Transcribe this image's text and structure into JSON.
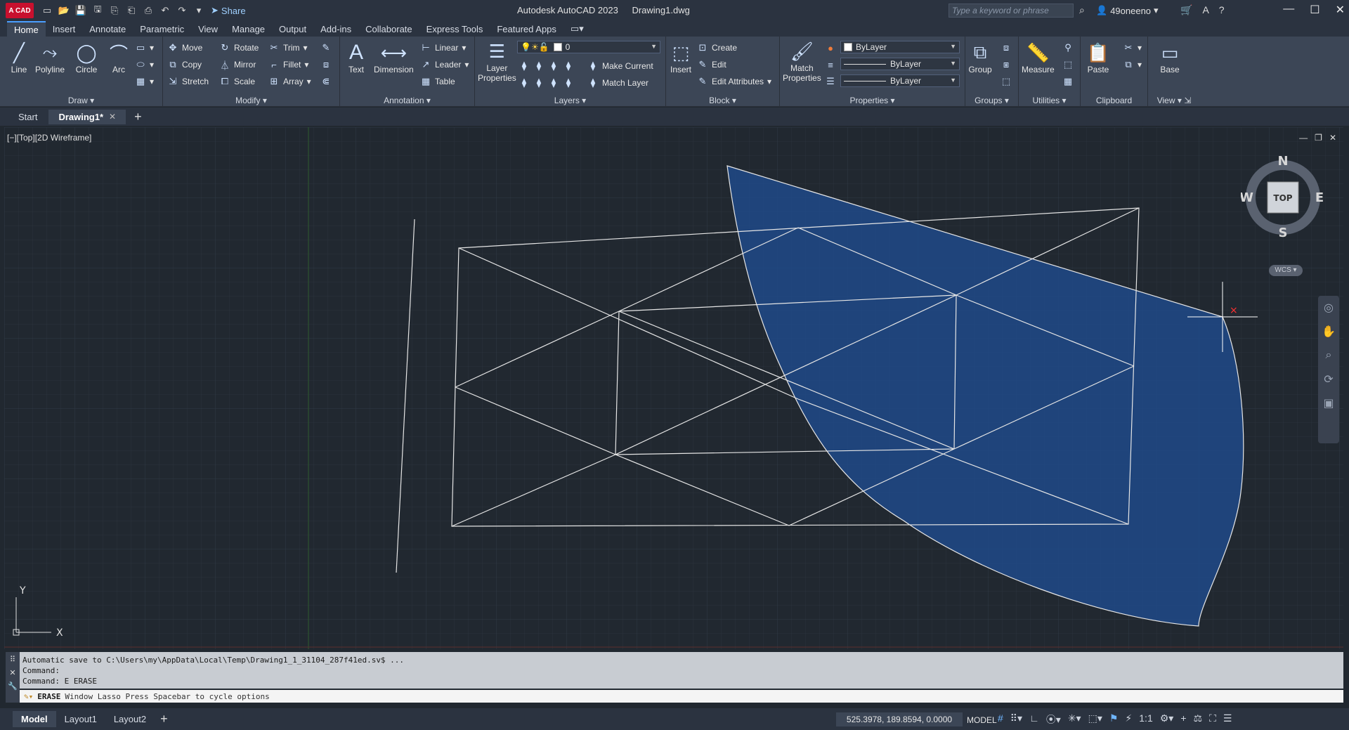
{
  "titlebar": {
    "logo": "A CAD",
    "share": "Share",
    "app_title": "Autodesk AutoCAD 2023",
    "doc_title": "Drawing1.dwg",
    "search_placeholder": "Type a keyword or phrase",
    "user": "49oneeno"
  },
  "ribbon_tabs": [
    "Home",
    "Insert",
    "Annotate",
    "Parametric",
    "View",
    "Manage",
    "Output",
    "Add-ins",
    "Collaborate",
    "Express Tools",
    "Featured Apps"
  ],
  "ribbon": {
    "draw": {
      "title": "Draw",
      "line": "Line",
      "polyline": "Polyline",
      "circle": "Circle",
      "arc": "Arc"
    },
    "modify": {
      "title": "Modify",
      "move": "Move",
      "rotate": "Rotate",
      "trim": "Trim",
      "copy": "Copy",
      "mirror": "Mirror",
      "fillet": "Fillet",
      "stretch": "Stretch",
      "scale": "Scale",
      "array": "Array"
    },
    "annotation": {
      "title": "Annotation",
      "text": "Text",
      "dimension": "Dimension",
      "linear": "Linear",
      "leader": "Leader",
      "table": "Table"
    },
    "layers": {
      "title": "Layers",
      "layer_properties_1": "Layer",
      "layer_properties_2": "Properties",
      "current_layer": "0",
      "make_current": "Make Current",
      "match_layer": "Match Layer"
    },
    "block": {
      "title": "Block",
      "insert": "Insert",
      "create": "Create",
      "edit": "Edit",
      "edit_attributes": "Edit Attributes"
    },
    "properties": {
      "title": "Properties",
      "match_1": "Match",
      "match_2": "Properties",
      "color": "ByLayer",
      "linetype": "ByLayer",
      "lineweight": "ByLayer"
    },
    "groups": {
      "title": "Groups",
      "group": "Group"
    },
    "utilities": {
      "title": "Utilities",
      "measure": "Measure"
    },
    "clipboard": {
      "title": "Clipboard",
      "paste": "Paste"
    },
    "view": {
      "title": "View",
      "base": "Base"
    }
  },
  "doc_tabs": {
    "start": "Start",
    "drawing": "Drawing1*"
  },
  "viewport": {
    "label": "[−][Top][2D Wireframe]",
    "cube_top": "TOP",
    "north": "N",
    "south": "S",
    "east": "E",
    "west": "W",
    "wcs": "WCS",
    "ucs_x": "X",
    "ucs_y": "Y"
  },
  "command": {
    "history": [
      "Automatic save to C:\\Users\\my\\AppData\\Local\\Temp\\Drawing1_1_31104_287f41ed.sv$ ...",
      "Command:",
      "Command: E ERASE"
    ],
    "prompt_kw": "ERASE",
    "prompt_opt": "Window Lasso  Press Spacebar to cycle options"
  },
  "status": {
    "layouts": [
      "Model",
      "Layout1",
      "Layout2"
    ],
    "coords": "525.3978, 189.8594, 0.0000",
    "model": "MODEL",
    "scale": "1:1"
  },
  "colors": {
    "accent": "#4a9eff",
    "hatch": "#1f4a8c",
    "canvas": "#212830"
  }
}
